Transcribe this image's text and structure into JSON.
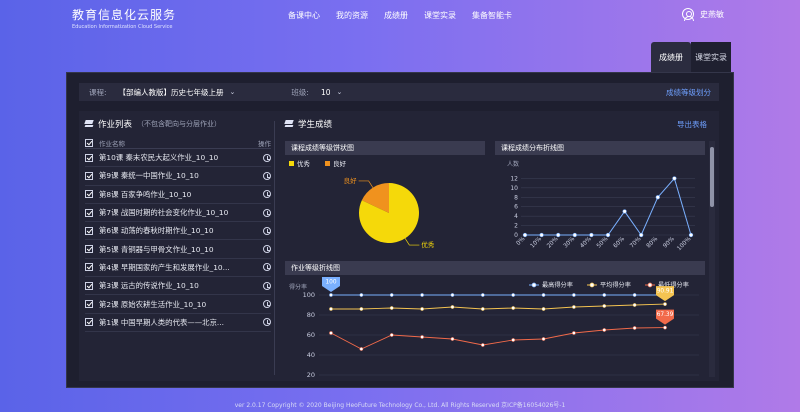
{
  "header": {
    "logo_cn": "教育信息化云服务",
    "logo_en": "Education Informatization Cloud Service",
    "nav": [
      "备课中心",
      "我的资源",
      "成绩册",
      "课堂实录",
      "集备智能卡"
    ],
    "user_name": "史燕敏"
  },
  "side_tabs": [
    "成绩册",
    "课堂实录"
  ],
  "filter": {
    "course_label": "课程:",
    "course_value": "【部编人教版】历史七年级上册",
    "class_label": "班级:",
    "class_value": "10",
    "grade_link": "成绩等级划分"
  },
  "homework": {
    "title": "作业列表",
    "subtitle": "（不包含靶向与分层作业）",
    "col_name": "作业名称",
    "col_action": "操作",
    "items": [
      "第10课 秦末农民大起义作业_10_10",
      "第9课 秦统一中国作业_10_10",
      "第8课 百家争鸣作业_10_10",
      "第7课 战国时期的社会变化作业_10_10",
      "第6课 动荡的春秋时期作业_10_10",
      "第5课 青铜器与甲骨文作业_10_10",
      "第4课 早期国家的产生和发展作业_10...",
      "第3课 远古的传说作业_10_10",
      "第2课 原始农耕生活作业_10_10",
      "第1课 中国早期人类的代表——北京..."
    ]
  },
  "results": {
    "title": "学生成绩",
    "export": "导出表格",
    "pie_title": "课程成绩等级饼状图",
    "dist_title": "课程成绩分布折线图",
    "line_title": "作业等级折线图"
  },
  "chart_data": [
    {
      "type": "pie",
      "title": "课程成绩等级饼状图",
      "legend": [
        "优秀",
        "良好"
      ],
      "labels": [
        "优秀",
        "良好"
      ],
      "values": [
        82,
        18
      ],
      "colors": [
        "#f5d90a",
        "#f0921e"
      ]
    },
    {
      "type": "line",
      "title": "课程成绩分布折线图",
      "ylabel": "人数",
      "categories": [
        "0%",
        "10%",
        "20%",
        "30%",
        "40%",
        "50%",
        "60%",
        "70%",
        "80%",
        "90%",
        "100%"
      ],
      "values": [
        0,
        0,
        0,
        0,
        0,
        0,
        5,
        0,
        8,
        12,
        0
      ],
      "yticks": [
        0,
        2,
        4,
        6,
        8,
        10,
        12
      ],
      "ylim": [
        0,
        14
      ],
      "color": "#7ab0ff"
    },
    {
      "type": "line",
      "title": "作业等级折线图",
      "ylabel": "得分率",
      "yticks": [
        20,
        40,
        60,
        80,
        100
      ],
      "ylim": [
        20,
        100
      ],
      "series": [
        {
          "name": "最高得分率",
          "color": "#7ab0ff",
          "values": [
            100,
            100,
            100,
            100,
            100,
            100,
            100,
            100,
            100,
            100,
            100,
            100
          ]
        },
        {
          "name": "平均得分率",
          "color": "#f5c451",
          "values": [
            86,
            86,
            87,
            86,
            88,
            86,
            87,
            86,
            88,
            89,
            90,
            90.91
          ]
        },
        {
          "name": "最低得分率",
          "color": "#f26a4a",
          "values": [
            62,
            46,
            60,
            58,
            56,
            50,
            55,
            56,
            62,
            65,
            67,
            67.39
          ]
        }
      ],
      "badges": [
        {
          "series": 0,
          "index": 0,
          "text": "100"
        },
        {
          "series": 1,
          "index": 11,
          "text": "90.91"
        },
        {
          "series": 2,
          "index": 11,
          "text": "67.39"
        }
      ]
    }
  ],
  "footer": "ver 2.0.17 Copyright © 2020 Beijing HeoFuture Technology Co., Ltd. All Rights Reserved 京ICP备16054026号-1"
}
